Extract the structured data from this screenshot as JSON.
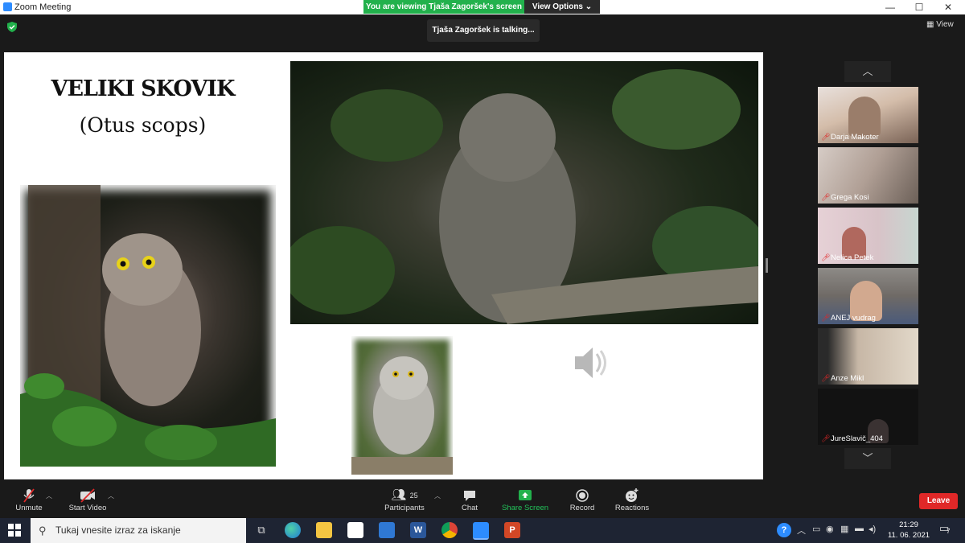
{
  "window": {
    "title": "Zoom Meeting",
    "minimize": "—",
    "maximize": "☐",
    "close": "✕"
  },
  "share_banner": {
    "viewing_text": "You are viewing Tjaša Zagoršek's screen",
    "view_options_label": "View Options ⌄"
  },
  "talking_indicator": "Tjaša Zagoršek is talking...",
  "view_button": {
    "icon": "grid-icon",
    "label": "View"
  },
  "slide": {
    "title": "VELIKI SKOVIK",
    "subtitle": "(Otus scops)"
  },
  "participants": [
    {
      "name": "Darja Makoter",
      "muted": true,
      "color": "#c8a995"
    },
    {
      "name": "Grega Kosi",
      "muted": true,
      "color": "#b7a79e"
    },
    {
      "name": "Nelica Petek",
      "muted": true,
      "color": "#d9c3c9"
    },
    {
      "name": "ANEJ vudrag",
      "muted": true,
      "color": "#7a6f69"
    },
    {
      "name": "Anze Mikl",
      "muted": true,
      "color": "#8a7a73"
    },
    {
      "name": "JureSlavič_404",
      "muted": true,
      "color": "#141414"
    }
  ],
  "toolbar": {
    "unmute": "Unmute",
    "start_video": "Start Video",
    "participants_label": "Participants",
    "participants_count": "25",
    "chat": "Chat",
    "share_screen": "Share Screen",
    "record": "Record",
    "reactions": "Reactions",
    "leave": "Leave"
  },
  "taskbar": {
    "search_placeholder": "Tukaj vnesite izraz za iskanje",
    "time": "21:29",
    "date": "11. 06. 2021",
    "notification_count": "7"
  },
  "colors": {
    "share_green": "#22b14c",
    "leave_red": "#e02828",
    "zoom_blue": "#2d8cff"
  }
}
